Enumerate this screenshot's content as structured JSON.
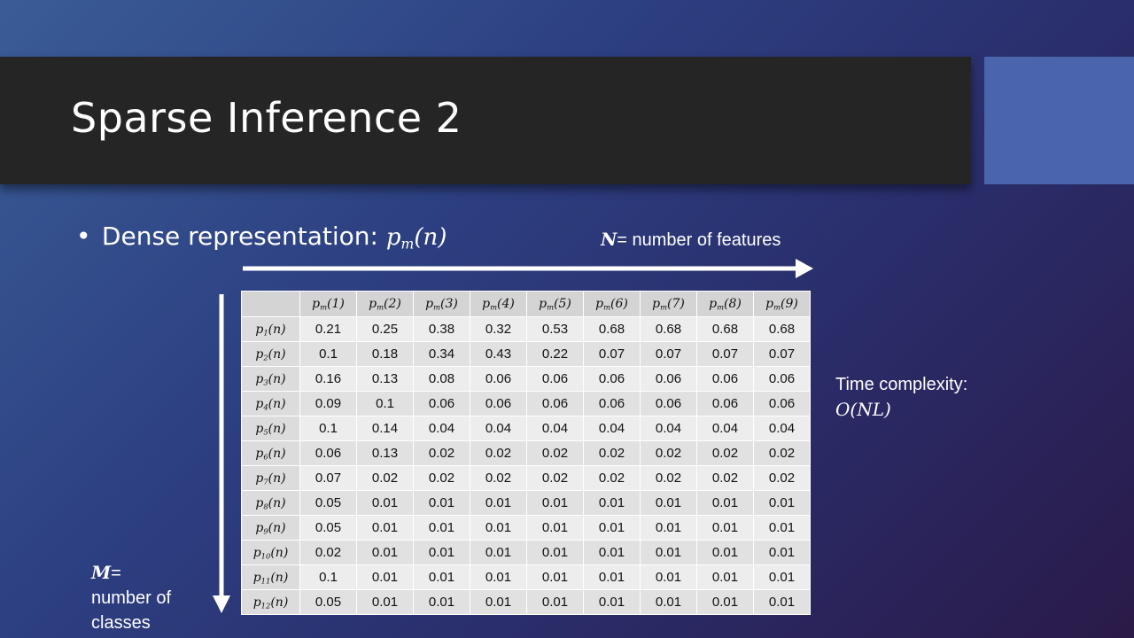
{
  "slide": {
    "title": "Sparse Inference 2",
    "bullet_text": "Dense representation:",
    "bullet_math": {
      "base": "p",
      "sub": "m",
      "arg": "(n)"
    },
    "n_label": {
      "symbol": "N",
      "text": "= number of features"
    },
    "m_label": {
      "symbol": "M",
      "text1": "=",
      "text2": "number of",
      "text3": "classes"
    },
    "time_label": {
      "line1": "Time complexity:",
      "math": "O(NL)"
    }
  },
  "colors": {
    "title_bar": "#252525",
    "accent": "#4a65ab"
  },
  "table": {
    "column_headers": [
      {
        "sub": "m",
        "arg": "(1)"
      },
      {
        "sub": "m",
        "arg": "(2)"
      },
      {
        "sub": "m",
        "arg": "(3)"
      },
      {
        "sub": "m",
        "arg": "(4)"
      },
      {
        "sub": "m",
        "arg": "(5)"
      },
      {
        "sub": "m",
        "arg": "(6)"
      },
      {
        "sub": "m",
        "arg": "(7)"
      },
      {
        "sub": "m",
        "arg": "(8)"
      },
      {
        "sub": "m",
        "arg": "(9)"
      }
    ],
    "rows": [
      {
        "sub": "1",
        "arg": "(n)",
        "values": [
          "0.21",
          "0.25",
          "0.38",
          "0.32",
          "0.53",
          "0.68",
          "0.68",
          "0.68",
          "0.68"
        ]
      },
      {
        "sub": "2",
        "arg": "(n)",
        "values": [
          "0.1",
          "0.18",
          "0.34",
          "0.43",
          "0.22",
          "0.07",
          "0.07",
          "0.07",
          "0.07"
        ]
      },
      {
        "sub": "3",
        "arg": "(n)",
        "values": [
          "0.16",
          "0.13",
          "0.08",
          "0.06",
          "0.06",
          "0.06",
          "0.06",
          "0.06",
          "0.06"
        ]
      },
      {
        "sub": "4",
        "arg": "(n)",
        "values": [
          "0.09",
          "0.1",
          "0.06",
          "0.06",
          "0.06",
          "0.06",
          "0.06",
          "0.06",
          "0.06"
        ]
      },
      {
        "sub": "5",
        "arg": "(n)",
        "values": [
          "0.1",
          "0.14",
          "0.04",
          "0.04",
          "0.04",
          "0.04",
          "0.04",
          "0.04",
          "0.04"
        ]
      },
      {
        "sub": "6",
        "arg": "(n)",
        "values": [
          "0.06",
          "0.13",
          "0.02",
          "0.02",
          "0.02",
          "0.02",
          "0.02",
          "0.02",
          "0.02"
        ]
      },
      {
        "sub": "7",
        "arg": "(n)",
        "values": [
          "0.07",
          "0.02",
          "0.02",
          "0.02",
          "0.02",
          "0.02",
          "0.02",
          "0.02",
          "0.02"
        ]
      },
      {
        "sub": "8",
        "arg": "(n)",
        "values": [
          "0.05",
          "0.01",
          "0.01",
          "0.01",
          "0.01",
          "0.01",
          "0.01",
          "0.01",
          "0.01"
        ]
      },
      {
        "sub": "9",
        "arg": "(n)",
        "values": [
          "0.05",
          "0.01",
          "0.01",
          "0.01",
          "0.01",
          "0.01",
          "0.01",
          "0.01",
          "0.01"
        ]
      },
      {
        "sub": "10",
        "arg": "(n)",
        "values": [
          "0.02",
          "0.01",
          "0.01",
          "0.01",
          "0.01",
          "0.01",
          "0.01",
          "0.01",
          "0.01"
        ]
      },
      {
        "sub": "11",
        "arg": "(n)",
        "values": [
          "0.1",
          "0.01",
          "0.01",
          "0.01",
          "0.01",
          "0.01",
          "0.01",
          "0.01",
          "0.01"
        ]
      },
      {
        "sub": "12",
        "arg": "(n)",
        "values": [
          "0.05",
          "0.01",
          "0.01",
          "0.01",
          "0.01",
          "0.01",
          "0.01",
          "0.01",
          "0.01"
        ]
      }
    ]
  }
}
